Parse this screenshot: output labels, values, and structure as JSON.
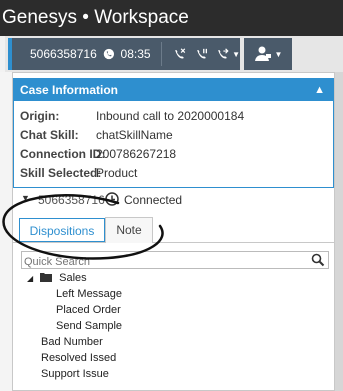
{
  "app": {
    "title": "Genesys • Workspace"
  },
  "toolbar": {
    "interaction_number": "5066358716",
    "timer": "08:35",
    "icons": [
      "call-timer-icon",
      "end-call-icon",
      "hold-call-icon",
      "transfer-call-icon",
      "agent-icon"
    ],
    "accent_color": "#2e8fcf"
  },
  "case_info": {
    "title": "Case Information",
    "rows": [
      {
        "label": "Origin:",
        "value": "Inbound call to 2020000184"
      },
      {
        "label": "Chat Skill:",
        "value": "chatSkillName"
      },
      {
        "label": "Connection ID:",
        "value": "200786267218"
      },
      {
        "label": "Skill Selected:",
        "value": "Product"
      }
    ]
  },
  "interaction": {
    "number": "5066358716",
    "status": "Connected"
  },
  "tabs": [
    {
      "label": "Dispositions"
    },
    {
      "label": "Note"
    }
  ],
  "search": {
    "placeholder": "Quick Search"
  },
  "dispositions": {
    "folder": "Sales",
    "folder_items": [
      "Left Message",
      "Placed Order",
      "Send Sample"
    ],
    "items": [
      "Bad Number",
      "Resolved Issed",
      "Support Issue"
    ]
  }
}
